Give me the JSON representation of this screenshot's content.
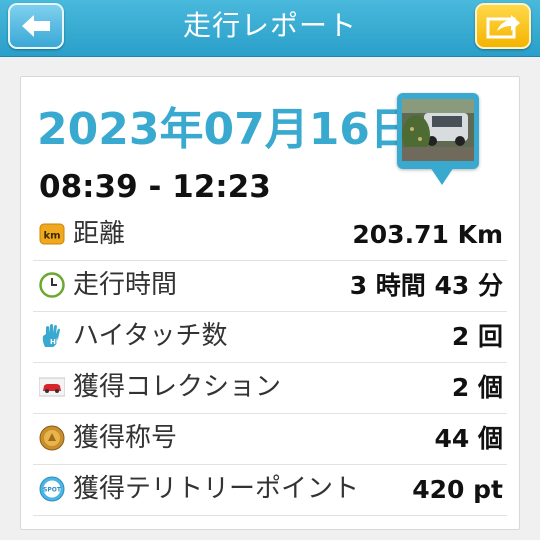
{
  "header": {
    "title": "走行レポート",
    "back_icon": "back-arrow-icon",
    "share_icon": "share-export-icon"
  },
  "report": {
    "date": "2023年07月16日",
    "time_range": "08:39 - 12:23",
    "photo_icon": "location-photo-pin"
  },
  "stats": [
    {
      "icon": "km-icon",
      "icon_text": "km",
      "label": "距離",
      "value": "203.71 Km"
    },
    {
      "icon": "clock-icon",
      "label": "走行時間",
      "value": "3 時間 43 分"
    },
    {
      "icon": "hi-five-hand-icon",
      "label": "ハイタッチ数",
      "value": "2 回"
    },
    {
      "icon": "car-collection-icon",
      "label": "獲得コレクション",
      "value": "2 個"
    },
    {
      "icon": "medal-icon",
      "label": "獲得称号",
      "value": "44 個"
    },
    {
      "icon": "spot-icon",
      "icon_text": "SPOT",
      "label": "獲得テリトリーポイント",
      "value": "420 pt"
    }
  ],
  "colors": {
    "accent": "#3aa9d0",
    "header": "#2a9fc9",
    "share": "#f5b400"
  }
}
